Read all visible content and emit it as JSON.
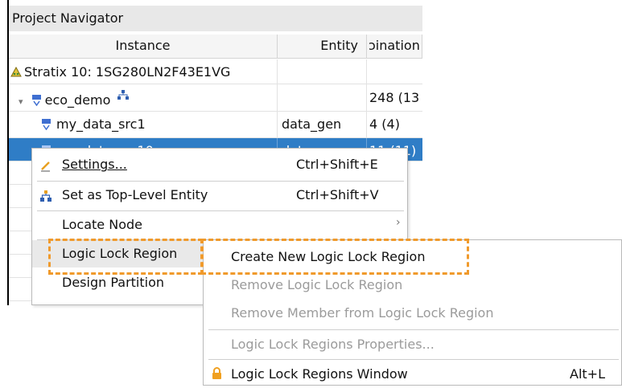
{
  "panel": {
    "title": "Project Navigator",
    "columns": {
      "instance": "Instance",
      "entity": "Entity",
      "combinational": "ɔination"
    },
    "rows": [
      {
        "instance": "Stratix 10: 1SG280LN2F43E1VG",
        "entity": "",
        "combinational": "",
        "icon": "warning-triangle-icon"
      },
      {
        "instance": "eco_demo",
        "entity": "",
        "combinational": "248 (13",
        "icon": "hierarchy-icon",
        "expander": "▾"
      },
      {
        "instance": "my_data_src1",
        "entity": "data_gen",
        "combinational": "4 (4)",
        "icon": "hierarchy-icon"
      },
      {
        "instance": "my_data_src10",
        "entity": "data_gen",
        "combinational": "11 (11)",
        "icon": "hierarchy-icon",
        "selected": true
      }
    ]
  },
  "context_menu": {
    "items": [
      {
        "label": "Settings...",
        "shortcut": "Ctrl+Shift+E",
        "icon": "settings-pencil-icon"
      },
      {
        "label": "Set as Top-Level Entity",
        "shortcut": "Ctrl+Shift+V",
        "icon": "hierarchy-top-icon"
      },
      {
        "label": "Locate Node",
        "submenu_arrow": "›"
      },
      {
        "label": "Logic Lock Region",
        "highlighted": true
      },
      {
        "label": "Design Partition"
      }
    ]
  },
  "submenu": {
    "items": [
      {
        "label": "Create New Logic Lock Region",
        "enabled": true
      },
      {
        "label": "Remove Logic Lock Region",
        "enabled": false
      },
      {
        "label": "Remove Member from Logic Lock Region",
        "enabled": false
      },
      {
        "label": "Logic Lock Regions Properties...",
        "enabled": false
      },
      {
        "label": "Logic Lock Regions Window",
        "shortcut": "Alt+L",
        "enabled": true,
        "icon": "lock-icon"
      }
    ]
  },
  "colors": {
    "selection": "#2f7dc6",
    "highlight_dash": "#f09a2c",
    "disabled_text": "#9b9b9b",
    "lock": "#f0a020"
  }
}
